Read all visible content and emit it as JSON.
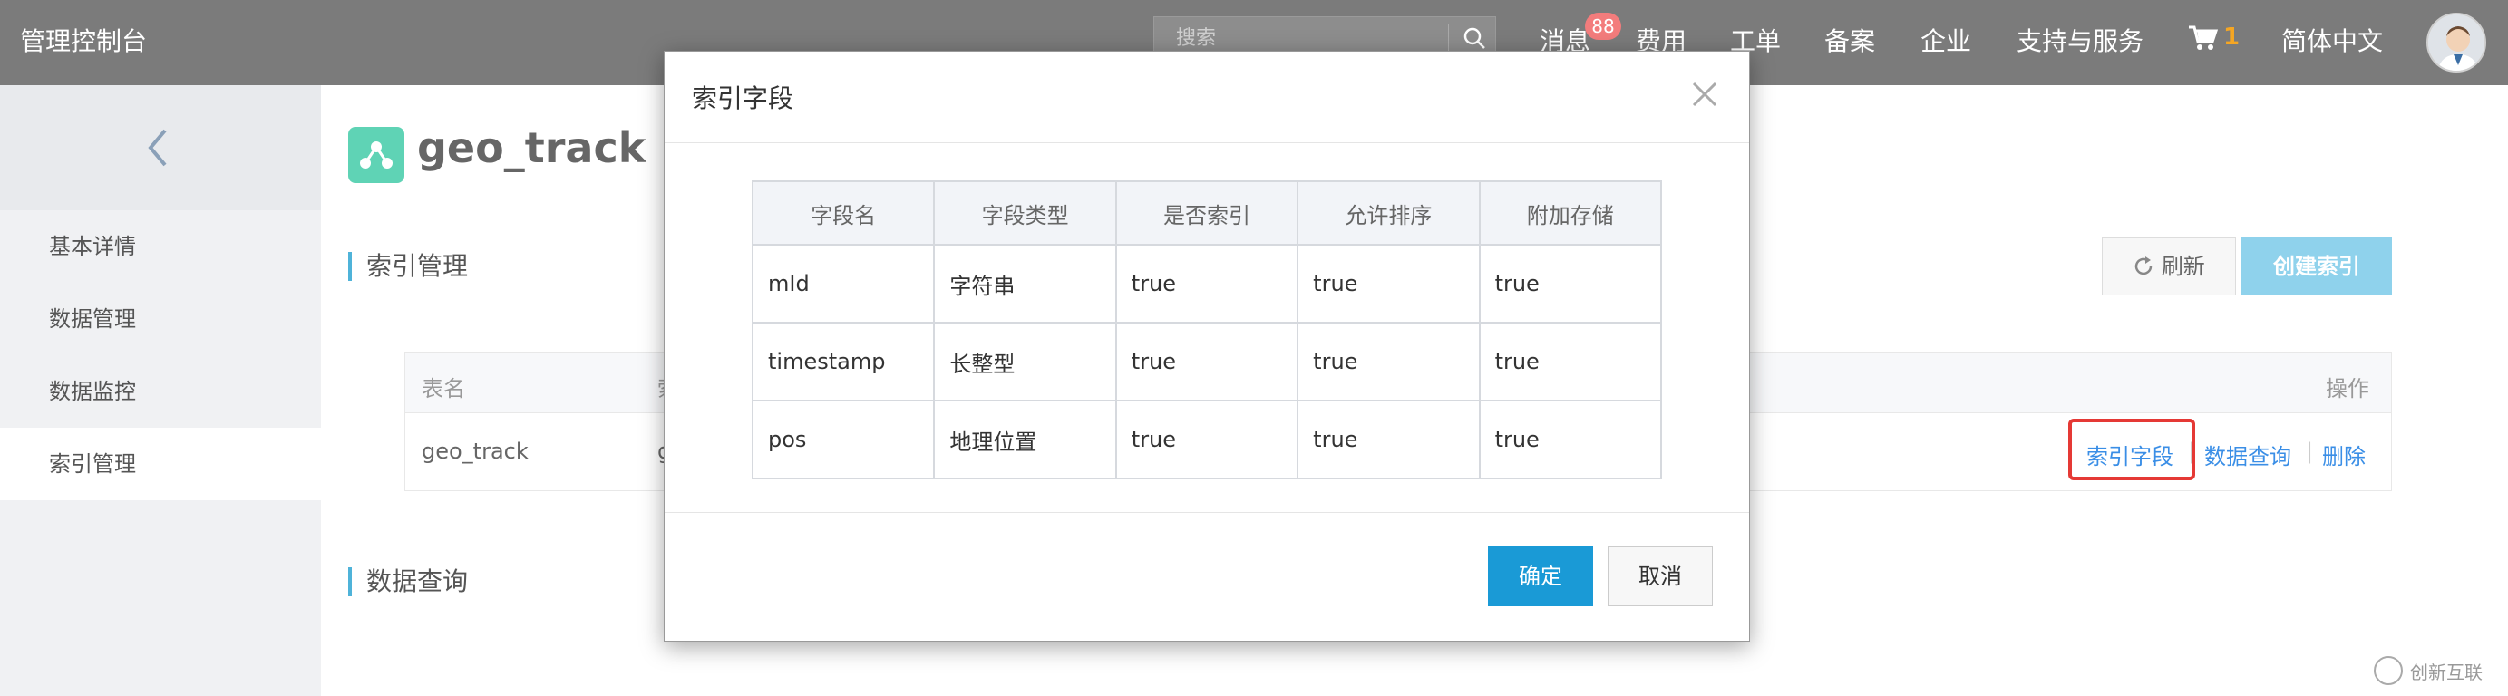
{
  "topbar": {
    "brand": "管理控制台",
    "search_placeholder": "搜索",
    "nav": {
      "messages": "消息",
      "messages_badge": "88",
      "billing": "费用",
      "tickets": "工单",
      "icp": "备案",
      "enterprise": "企业",
      "support": "支持与服务",
      "cart_count": "1",
      "language": "简体中文"
    }
  },
  "sidebar": {
    "items": [
      {
        "label": "基本详情"
      },
      {
        "label": "数据管理"
      },
      {
        "label": "数据监控"
      },
      {
        "label": "索引管理"
      }
    ]
  },
  "main": {
    "title": "geo_track",
    "index_section": "索引管理",
    "query_section": "数据查询",
    "refresh_label": "刷新",
    "create_label": "创建索引",
    "table": {
      "headers": {
        "name": "表名",
        "partial": "索",
        "ops": "操作"
      },
      "row": {
        "name": "geo_track",
        "partial": "g"
      },
      "ops": [
        "索引字段",
        "数据查询",
        "删除"
      ],
      "sep": "|"
    }
  },
  "modal": {
    "title": "索引字段",
    "columns": [
      "字段名",
      "字段类型",
      "是否索引",
      "允许排序",
      "附加存储"
    ],
    "rows": [
      [
        "mId",
        "字符串",
        "true",
        "true",
        "true"
      ],
      [
        "timestamp",
        "长整型",
        "true",
        "true",
        "true"
      ],
      [
        "pos",
        "地理位置",
        "true",
        "true",
        "true"
      ]
    ],
    "ok_label": "确定",
    "cancel_label": "取消"
  },
  "watermark": "创新互联",
  "colors": {
    "topbar": "#7b7b7b",
    "primary": "#1a9ad6",
    "link": "#3a8ee6",
    "highlight": "#e53935",
    "cart_count": "#f5a623"
  }
}
